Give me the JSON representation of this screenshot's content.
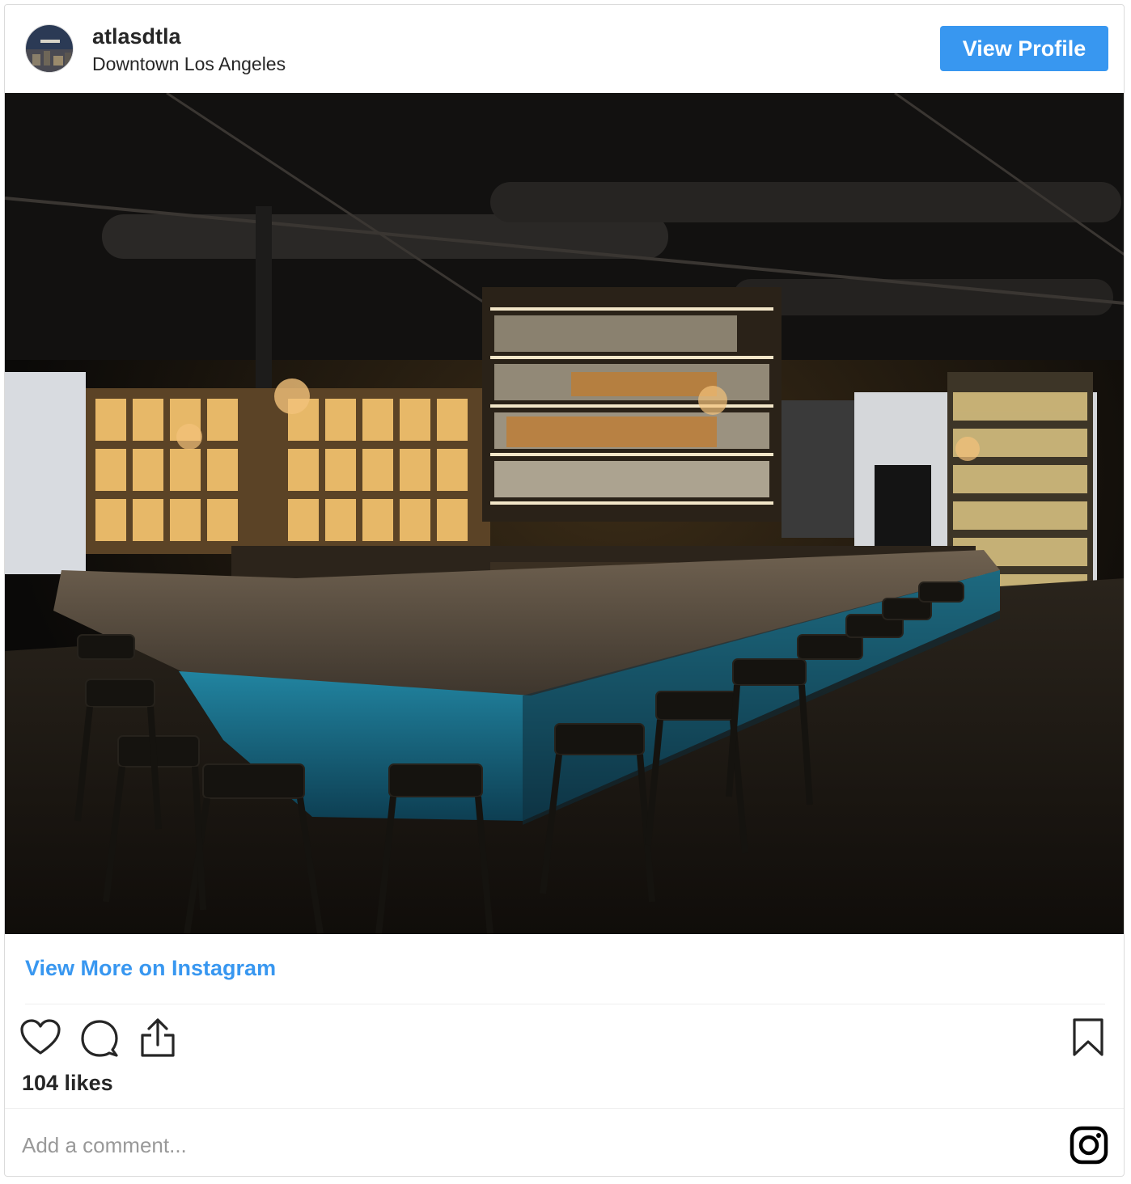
{
  "post": {
    "username": "atlasdtla",
    "location": "Downtown Los Angeles",
    "view_profile_label": "View Profile",
    "view_more_label": "View More on Instagram",
    "likes": "104 likes",
    "comment_placeholder": "Add a comment..."
  },
  "icons": {
    "like": "heart-icon",
    "comment": "comment-bubble-icon",
    "share": "share-icon",
    "save": "bookmark-icon",
    "brand": "instagram-logo-icon"
  },
  "colors": {
    "accent": "#3897f0",
    "text": "#262626",
    "placeholder": "#999999",
    "border": "#dbdbdb"
  }
}
